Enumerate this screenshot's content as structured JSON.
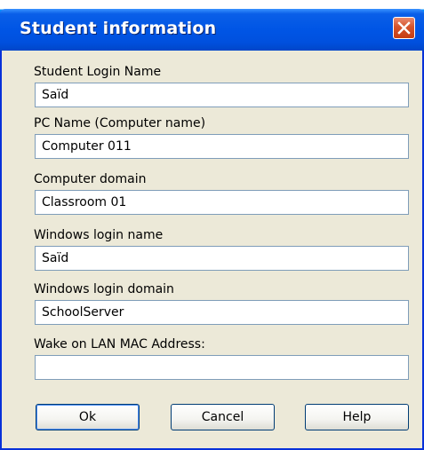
{
  "dialog": {
    "title": "Student information"
  },
  "fields": [
    {
      "label": "Student Login Name",
      "value": "Saïd",
      "placeholder": ""
    },
    {
      "label": "PC Name (Computer name)",
      "value": "Computer 011",
      "placeholder": ""
    },
    {
      "label": "Computer domain",
      "value": "Classroom 01",
      "placeholder": ""
    },
    {
      "label": "Windows login name",
      "value": "Saïd",
      "placeholder": ""
    },
    {
      "label": "Windows login domain",
      "value": "SchoolServer",
      "placeholder": ""
    },
    {
      "label": "Wake on LAN MAC Address:",
      "value": "",
      "placeholder": ""
    }
  ],
  "buttons": {
    "ok": "Ok",
    "cancel": "Cancel",
    "help": "Help"
  },
  "colors": {
    "titlebar": "#0055e5",
    "close_button": "#d4532b",
    "dialog_background": "#ece9d8",
    "input_border": "#7f9db9"
  },
  "icons": {
    "close": "close-icon"
  }
}
